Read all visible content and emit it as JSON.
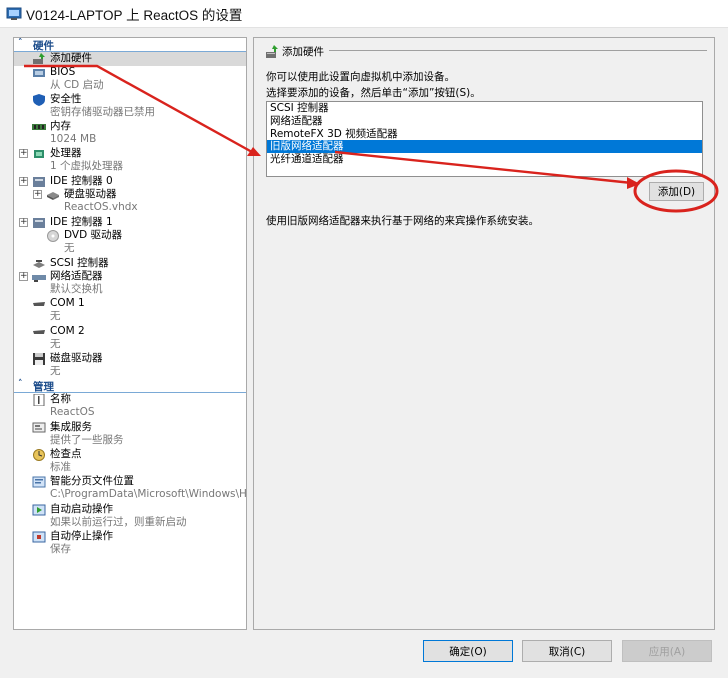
{
  "window": {
    "title": "V0124-LAPTOP 上 ReactOS 的设置"
  },
  "tree": {
    "hardware_section": "硬件",
    "management_section": "管理",
    "hardware": [
      {
        "label": "添加硬件",
        "sub": "",
        "icon": "add-hardware-icon"
      },
      {
        "label": "BIOS",
        "sub": "从 CD 启动",
        "icon": "bios-chip-icon"
      },
      {
        "label": "安全性",
        "sub": "密钥存储驱动器已禁用",
        "icon": "shield-icon"
      },
      {
        "label": "内存",
        "sub": "1024 MB",
        "icon": "memory-icon"
      },
      {
        "label": "处理器",
        "sub": "1 个虚拟处理器",
        "icon": "processor-icon"
      },
      {
        "label": "IDE 控制器 0",
        "sub": "",
        "icon": "ide-controller-icon"
      },
      {
        "label": "硬盘驱动器",
        "sub": "ReactOS.vhdx",
        "icon": "hard-drive-icon"
      },
      {
        "label": "IDE 控制器 1",
        "sub": "",
        "icon": "ide-controller-icon"
      },
      {
        "label": "DVD 驱动器",
        "sub": "无",
        "icon": "dvd-icon"
      },
      {
        "label": "SCSI 控制器",
        "sub": "",
        "icon": "scsi-controller-icon"
      },
      {
        "label": "网络适配器",
        "sub": "默认交换机",
        "icon": "network-adapter-icon"
      },
      {
        "label": "COM 1",
        "sub": "无",
        "icon": "com-port-icon"
      },
      {
        "label": "COM 2",
        "sub": "无",
        "icon": "com-port-icon"
      },
      {
        "label": "磁盘驱动器",
        "sub": "无",
        "icon": "floppy-icon"
      }
    ],
    "management": [
      {
        "label": "名称",
        "sub": "ReactOS",
        "icon": "name-icon"
      },
      {
        "label": "集成服务",
        "sub": "提供了一些服务",
        "icon": "integration-services-icon"
      },
      {
        "label": "检查点",
        "sub": "标准",
        "icon": "checkpoint-icon"
      },
      {
        "label": "智能分页文件位置",
        "sub": "C:\\ProgramData\\Microsoft\\Windows\\Hyper-V",
        "icon": "paging-file-icon"
      },
      {
        "label": "自动启动操作",
        "sub": "如果以前运行过，则重新启动",
        "icon": "auto-start-icon"
      },
      {
        "label": "自动停止操作",
        "sub": "保存",
        "icon": "auto-stop-icon"
      }
    ]
  },
  "panel": {
    "title": "添加硬件",
    "description": "你可以使用此设置向虚拟机中添加设备。",
    "instruction": "选择要添加的设备，然后单击“添加”按钮(S)。",
    "devices": [
      "SCSI 控制器",
      "网络适配器",
      "RemoteFX 3D 视频适配器",
      "旧版网络适配器",
      "光纤通道适配器"
    ],
    "selected_device": "旧版网络适配器",
    "add_button": "添加(D)",
    "info": "使用旧版网络适配器来执行基于网络的来宾操作系统安装。"
  },
  "buttons": {
    "ok": "确定(O)",
    "cancel": "取消(C)",
    "apply": "应用(A)"
  },
  "colors": {
    "selection": "#0078d7",
    "annotation": "#d9231d",
    "section_header": "#1e4e8c"
  }
}
